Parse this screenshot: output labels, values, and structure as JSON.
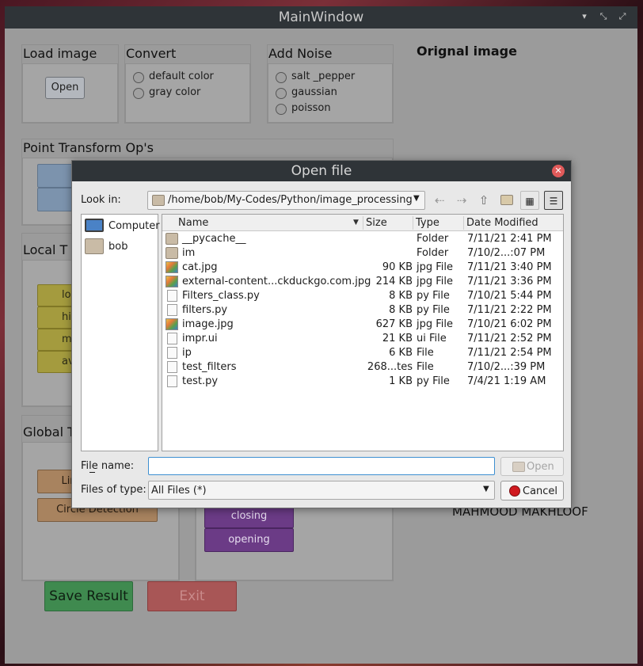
{
  "window": {
    "title": "MainWindow"
  },
  "load_image": {
    "title": "Load image",
    "open_label": "Open"
  },
  "convert": {
    "title": "Convert",
    "options": [
      "default color",
      "gray color"
    ]
  },
  "add_noise": {
    "title": "Add Noise",
    "options": [
      "salt _pepper",
      "gaussian",
      "poisson"
    ]
  },
  "point_transform": {
    "title": "Point Transform Op's"
  },
  "local": {
    "title": "Local  T",
    "buttons": [
      "lo",
      "hig",
      "m",
      "ave"
    ]
  },
  "global": {
    "title": "Global T",
    "buttons": [
      "Lin",
      "Circle Detection"
    ]
  },
  "morph": {
    "buttons": [
      "closing",
      "opening"
    ]
  },
  "original_image_label": "Orignal image",
  "author": "MAHMOOD MAKHLOOF",
  "bottom": {
    "save_label": "Save Result",
    "exit_label": "Exit"
  },
  "dialog": {
    "title": "Open file",
    "look_in_label": "Look in:",
    "path": "/home/bob/My-Codes/Python/image_processing",
    "places": [
      {
        "label": "Computer",
        "icon": "computer-icon"
      },
      {
        "label": "bob",
        "icon": "folder-icon"
      }
    ],
    "columns": {
      "name": "Name",
      "size": "Size",
      "type": "Type",
      "date": "Date Modified"
    },
    "files": [
      {
        "name": "__pycache__",
        "size": "",
        "type": "Folder",
        "date": "7/11/21 2:41 PM",
        "icon": "folder-icon"
      },
      {
        "name": "im",
        "size": "",
        "type": "Folder",
        "date": "7/10/2...:07 PM",
        "icon": "folder-icon"
      },
      {
        "name": "cat.jpg",
        "size": "90 KB",
        "type": "jpg File",
        "date": "7/11/21 3:40 PM",
        "icon": "image-file-icon"
      },
      {
        "name": "external-content...ckduckgo.com.jpg",
        "size": "214 KB",
        "type": "jpg File",
        "date": "7/11/21 3:36 PM",
        "icon": "image-file-icon"
      },
      {
        "name": "Filters_class.py",
        "size": "8 KB",
        "type": "py File",
        "date": "7/10/21 5:44 PM",
        "icon": "document-icon"
      },
      {
        "name": "filters.py",
        "size": "8 KB",
        "type": "py File",
        "date": "7/11/21 2:22 PM",
        "icon": "document-icon"
      },
      {
        "name": "image.jpg",
        "size": "627 KB",
        "type": "jpg File",
        "date": "7/10/21 6:02 PM",
        "icon": "image-file-icon"
      },
      {
        "name": "impr.ui",
        "size": "21 KB",
        "type": "ui File",
        "date": "7/11/21 2:52 PM",
        "icon": "document-icon"
      },
      {
        "name": "ip",
        "size": "6 KB",
        "type": "File",
        "date": "7/11/21 2:54 PM",
        "icon": "document-icon"
      },
      {
        "name": "test_filters",
        "size": "268...tes",
        "type": "File",
        "date": "7/10/2...:39 PM",
        "icon": "document-icon"
      },
      {
        "name": "test.py",
        "size": "1 KB",
        "type": "py File",
        "date": "7/4/21 1:19 AM",
        "icon": "document-icon"
      }
    ],
    "file_name_label": "File name:",
    "file_name_value": "",
    "files_of_type_label": "Files of type:",
    "files_of_type_value": "All Files (*)",
    "open_label": "Open",
    "cancel_label": "Cancel"
  }
}
